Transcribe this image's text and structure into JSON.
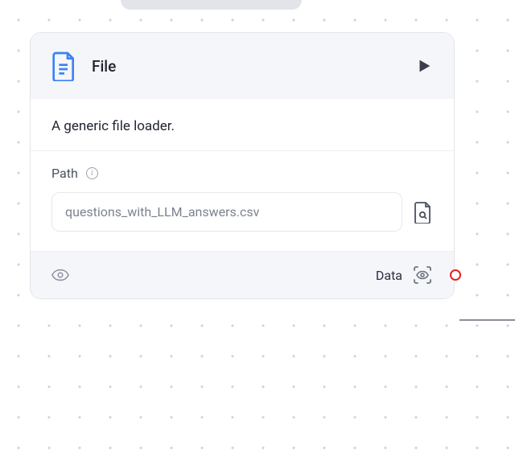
{
  "node": {
    "title": "File",
    "description": "A generic file loader.",
    "fields": {
      "path": {
        "label": "Path",
        "value": "questions_with_LLM_answers.csv"
      }
    },
    "output": {
      "label": "Data"
    }
  },
  "icons": {
    "file": "file-icon",
    "play": "play-icon",
    "info": "info-icon",
    "browse": "file-search-icon",
    "eye": "eye-icon",
    "scan": "scan-eye-icon"
  }
}
